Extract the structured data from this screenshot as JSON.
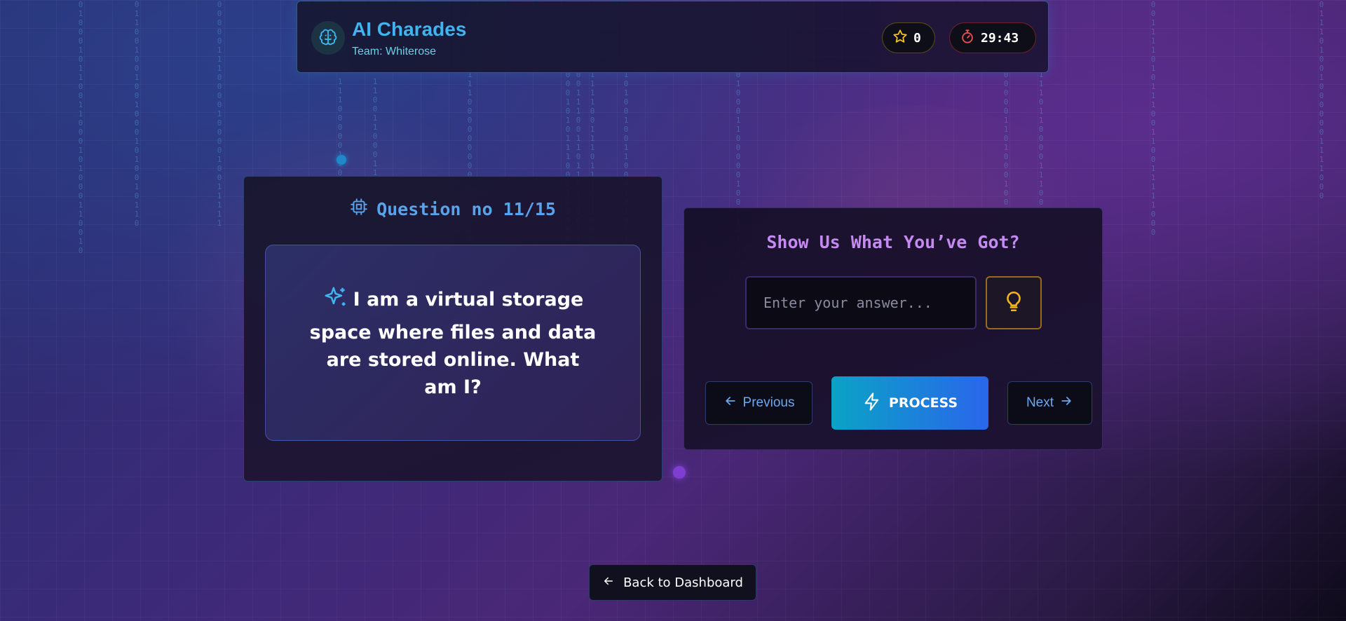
{
  "header": {
    "title": "AI Charades",
    "team_label": "Team: Whiterose",
    "score": "0",
    "timer": "29:43"
  },
  "question": {
    "heading": "Question no 11/15",
    "text": "I am a virtual storage space where files and data are stored online. What am I?"
  },
  "answer": {
    "heading": "Show Us What You’ve Got?",
    "placeholder": "Enter your answer...",
    "value": "",
    "previous_label": "Previous",
    "process_label": "PROCESS",
    "next_label": "Next"
  },
  "footer": {
    "back_label": "Back to Dashboard"
  },
  "icons": {
    "brand": "brain-icon",
    "score": "star-icon",
    "timer": "stopwatch-icon",
    "question": "cpu-chip-icon",
    "question_text": "sparkles-icon",
    "hint": "lightbulb-icon",
    "previous": "arrow-left-icon",
    "process": "lightning-icon",
    "next": "arrow-right-icon",
    "back": "arrow-left-icon"
  },
  "colors": {
    "accent_cyan": "#3fb4ef",
    "accent_purple": "#c58af2",
    "question_blue": "#5aa2ea",
    "hint_amber": "#f2b41c",
    "timer_red": "#e8504a",
    "star_yellow": "#f0c419"
  }
}
